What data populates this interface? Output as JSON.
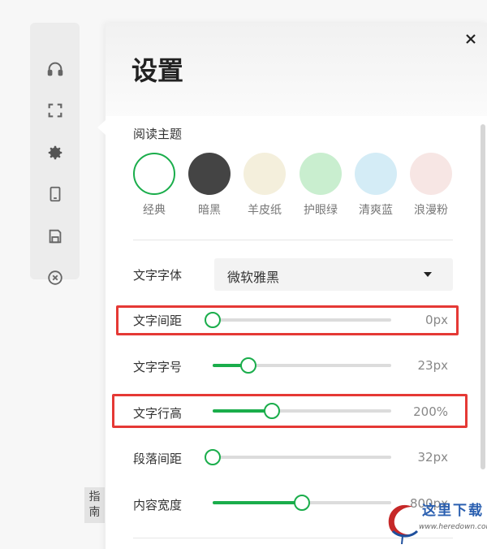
{
  "toolbar": {
    "items": [
      {
        "icon": "headphones-icon"
      },
      {
        "icon": "fullscreen-icon"
      },
      {
        "icon": "gear-icon"
      },
      {
        "icon": "tablet-icon"
      },
      {
        "icon": "save-icon"
      },
      {
        "icon": "close-circle-icon"
      }
    ]
  },
  "guide": {
    "line1": "指",
    "line2": "南"
  },
  "panel": {
    "title": "设置",
    "close_symbol": "×",
    "theme_label": "阅读主题",
    "themes": [
      {
        "name": "经典",
        "color": "#ffffff",
        "selected": true
      },
      {
        "name": "暗黑",
        "color": "#444444",
        "selected": false
      },
      {
        "name": "羊皮纸",
        "color": "#f4efdc",
        "selected": false
      },
      {
        "name": "护眼绿",
        "color": "#c9eecf",
        "selected": false
      },
      {
        "name": "清爽蓝",
        "color": "#d4ecf6",
        "selected": false
      },
      {
        "name": "浪漫粉",
        "color": "#f7e6e4",
        "selected": false
      }
    ],
    "font_family": {
      "label": "文字字体",
      "value": "微软雅黑"
    },
    "sliders": [
      {
        "label": "文字间距",
        "value": "0px",
        "percent": 0
      },
      {
        "label": "文字字号",
        "value": "23px",
        "percent": 20
      },
      {
        "label": "文字行高",
        "value": "200%",
        "percent": 33
      },
      {
        "label": "段落间距",
        "value": "32px",
        "percent": 0
      },
      {
        "label": "内容宽度",
        "value": "800px",
        "percent": 50
      }
    ]
  },
  "watermark": {
    "cn": "这里下载",
    "url": "www.heredown.com"
  },
  "colors": {
    "accent": "#1aad4b",
    "highlight": "#e53935"
  }
}
